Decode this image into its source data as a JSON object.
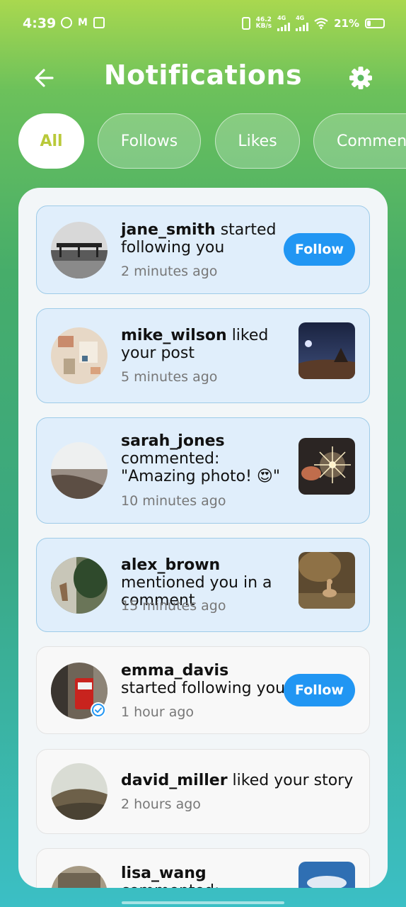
{
  "status_bar": {
    "time": "4:39",
    "net_speed_value": "46.2",
    "net_speed_unit": "KB/s",
    "net_type_1": "4G",
    "net_type_2": "4G",
    "battery_percent": "21%",
    "battery_level": 0.21,
    "icons": [
      "whatsapp-icon",
      "gmail-icon",
      "vo-icon",
      "vibrate-icon",
      "signal-icon",
      "wifi-icon",
      "battery-icon"
    ]
  },
  "header": {
    "title": "Notifications",
    "back_icon": "arrow-left-icon",
    "settings_icon": "gear-icon"
  },
  "tabs": [
    {
      "label": "All",
      "active": true
    },
    {
      "label": "Follows",
      "active": false
    },
    {
      "label": "Likes",
      "active": false
    },
    {
      "label": "Comments",
      "active": false
    }
  ],
  "notifications": [
    {
      "username": "jane_smith",
      "action": " started following you",
      "time": "2 minutes ago",
      "action_button": "Follow",
      "unread": true
    },
    {
      "username": "mike_wilson",
      "action": " liked your post",
      "time": "5 minutes ago",
      "unread": true
    },
    {
      "username": "sarah_jones",
      "action": " commented: \"Amazing photo! 😍\"",
      "time": "10 minutes ago",
      "unread": true
    },
    {
      "username": "alex_brown",
      "action": " mentioned you in a comment",
      "time": "15 minutes ago",
      "unread": true
    },
    {
      "username": "emma_davis",
      "action": " started following you",
      "time": "1 hour ago",
      "action_button": "Follow",
      "unread": false,
      "verified": true
    },
    {
      "username": "david_miller",
      "action": " liked your story",
      "time": "2 hours ago",
      "unread": false
    },
    {
      "username": "lisa_wang",
      "action": " commented:",
      "time": "",
      "unread": false
    }
  ],
  "colors": {
    "accent": "#2196f3",
    "active_tab_text": "#b9c93a",
    "unread_bg": "#e0eefb",
    "read_bg": "#f8f8f8"
  }
}
